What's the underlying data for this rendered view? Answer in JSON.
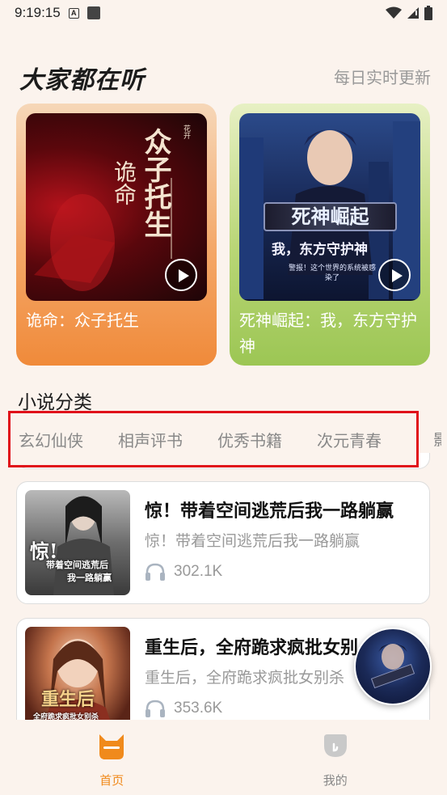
{
  "status_bar": {
    "time": "9:19:15",
    "a_badge": "A"
  },
  "section": {
    "title": "大家都在听",
    "subtitle": "每日实时更新"
  },
  "featured": [
    {
      "title": "诡命：众子托生",
      "cover_text": {
        "main": "众子托生",
        "side": "诡命",
        "small": "花开"
      }
    },
    {
      "title": "死神崛起：我，东方守护神",
      "cover_text": {
        "banner": "死神崛起",
        "sub": "我，东方守护神",
        "tiny": "警报！这个世界的系统被感染了"
      }
    }
  ],
  "categories": {
    "heading": "小说分类",
    "items": [
      "玄幻仙侠",
      "相声评书",
      "优秀书籍",
      "次元青春"
    ]
  },
  "books": [
    {
      "title": "惊！带着空间逃荒后我一路躺赢",
      "subtitle": "惊！带着空间逃荒后我一路躺赢",
      "plays": "302.1K",
      "cover_text": {
        "big": "惊!",
        "line": "带着空间逃荒后",
        "line2": "我一路躺赢"
      }
    },
    {
      "title": "重生后，全府跪求疯批女别",
      "subtitle": "重生后，全府跪求疯批女别杀",
      "plays": "353.6K",
      "cover_text": {
        "big": "重生后",
        "line": "全府跪求疯批女别杀"
      }
    }
  ],
  "nav": {
    "home": "首页",
    "mine": "我的"
  },
  "colors": {
    "accent": "#f08a1c",
    "highlight_border": "#e0101a"
  }
}
